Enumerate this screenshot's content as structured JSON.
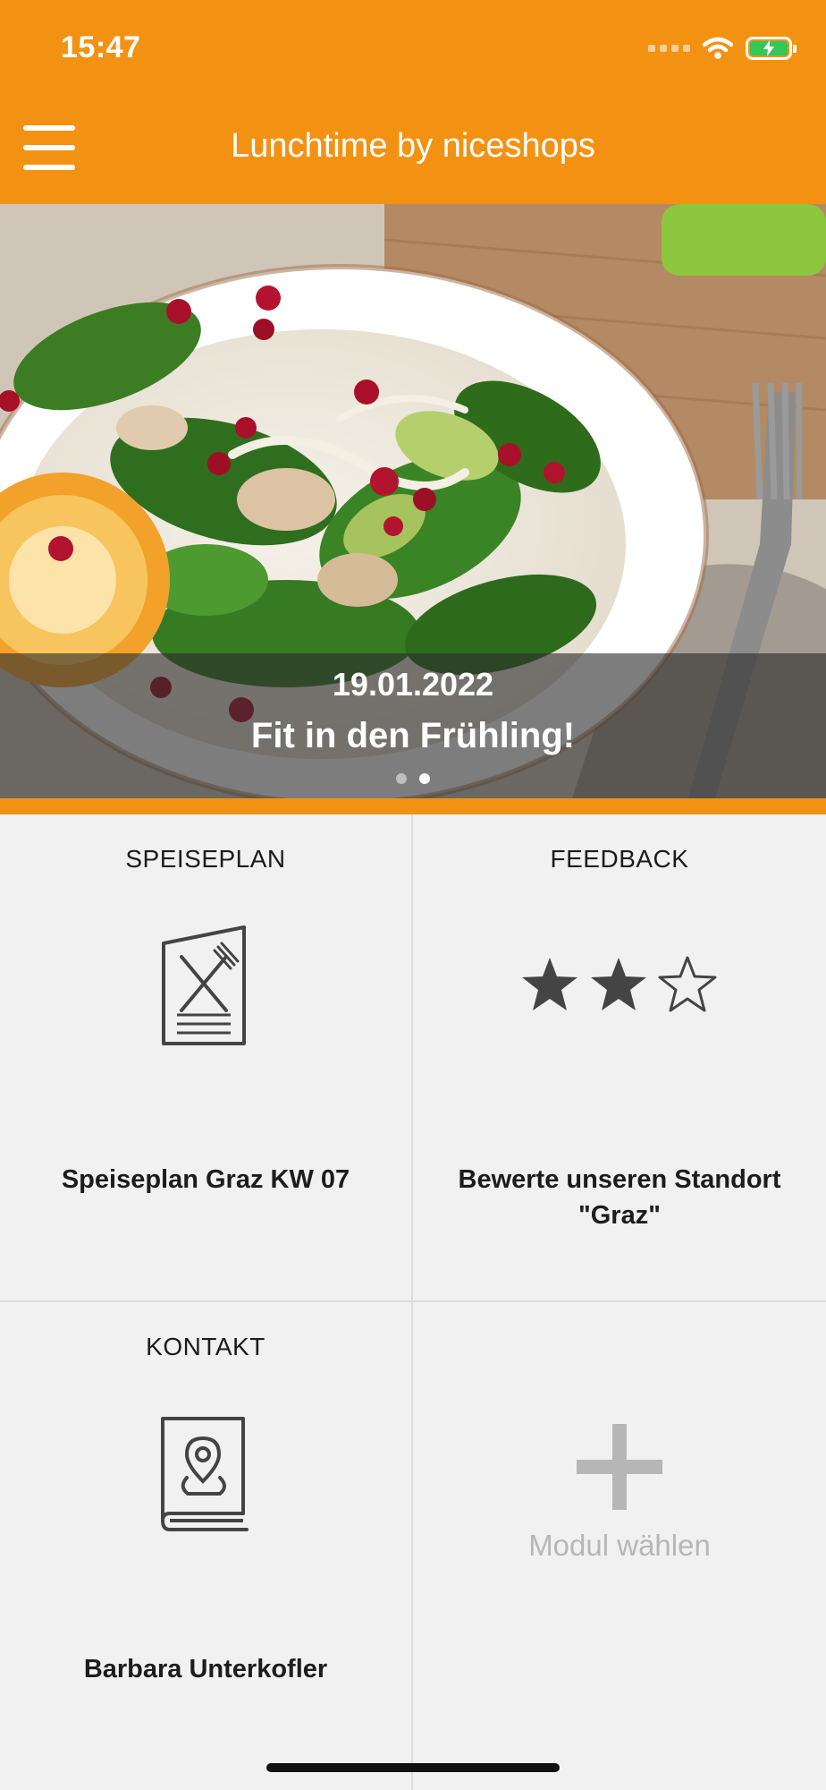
{
  "status_bar": {
    "time": "15:47"
  },
  "header": {
    "title": "Lunchtime by niceshops",
    "menu_icon": "hamburger-menu-icon"
  },
  "hero": {
    "date": "19.01.2022",
    "title": "Fit in den Frühling!",
    "slide_count": 2,
    "active_slide": 2
  },
  "tiles": {
    "menu": {
      "label": "SPEISEPLAN",
      "value": "Speiseplan Graz KW 07",
      "icon": "menu-card-icon"
    },
    "feedback": {
      "label": "FEEDBACK",
      "value": "Bewerte unseren Standort \"Graz\"",
      "icon": "star-rating-icon",
      "rating": 2,
      "rating_max": 3
    },
    "contact": {
      "label": "KONTAKT",
      "value": "Barbara Unterkofler",
      "icon": "address-book-icon"
    },
    "add_module": {
      "label": "Modul wählen",
      "icon": "plus-icon"
    }
  },
  "colors": {
    "brand_orange": "#f39212",
    "tile_background": "#f2f1f2",
    "icon_gray": "#444444",
    "muted_gray": "#b7b6b7"
  }
}
